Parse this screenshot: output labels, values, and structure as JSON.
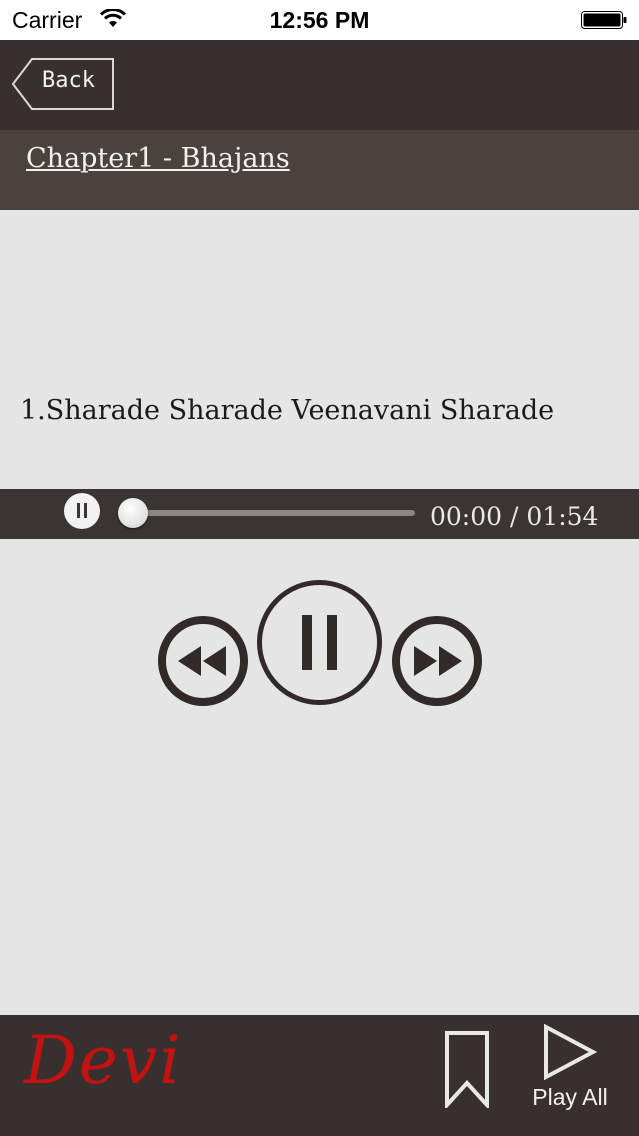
{
  "status_bar": {
    "carrier": "Carrier",
    "time": "12:56 PM"
  },
  "nav": {
    "back_label": "Back"
  },
  "chapter": {
    "title": "Chapter1 - Bhajans"
  },
  "song": {
    "title": "1.Sharade Sharade Veenavani Sharade"
  },
  "player": {
    "current_time": "00:00",
    "separator": "/",
    "duration": "01:54",
    "progress": 0
  },
  "controls": {
    "rewind_icon": "rewind-icon",
    "play_pause_icon": "pause-icon",
    "forward_icon": "fast-forward-icon"
  },
  "bottom": {
    "logo_text": "Devi",
    "bookmark_icon": "bookmark-icon",
    "play_all_label": "Play All"
  },
  "colors": {
    "nav_bg": "#38302e",
    "chapter_bg": "#4a423f",
    "content_bg": "#e6e5e5",
    "logo": "#c21212"
  }
}
